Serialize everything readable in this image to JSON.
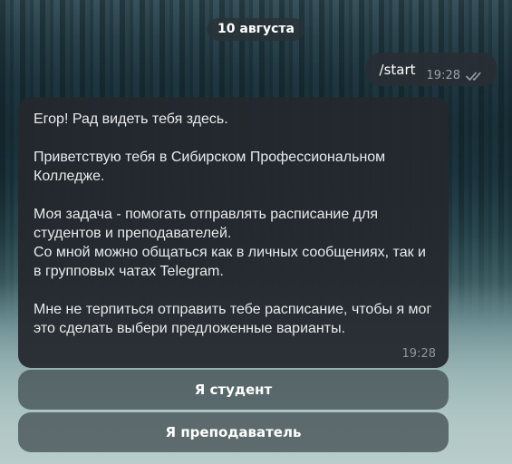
{
  "date_separator": "10 августа",
  "outgoing_message": {
    "text": "/start",
    "time": "19:28",
    "status_icon": "double-check-icon"
  },
  "incoming_message": {
    "paragraphs": [
      "Егор! Рад видеть тебя здесь.",
      "Приветствую тебя в Сибирском Профессиональном Колледже.",
      "Моя задача - помогать отправлять расписание для студентов и преподавателей.\nСо мной можно общаться как в личных сообщениях, так и в групповых чатах Telegram.",
      "Мне не терпиться отправить тебе расписание, чтобы я мог это сделать выбери предложенные варианты."
    ],
    "time": "19:28"
  },
  "keyboard": {
    "buttons": [
      "Я студент",
      "Я преподаватель"
    ]
  },
  "colors": {
    "bubble": "#24282e",
    "button": "#3c464b",
    "meta_text": "#9aa3aa"
  }
}
